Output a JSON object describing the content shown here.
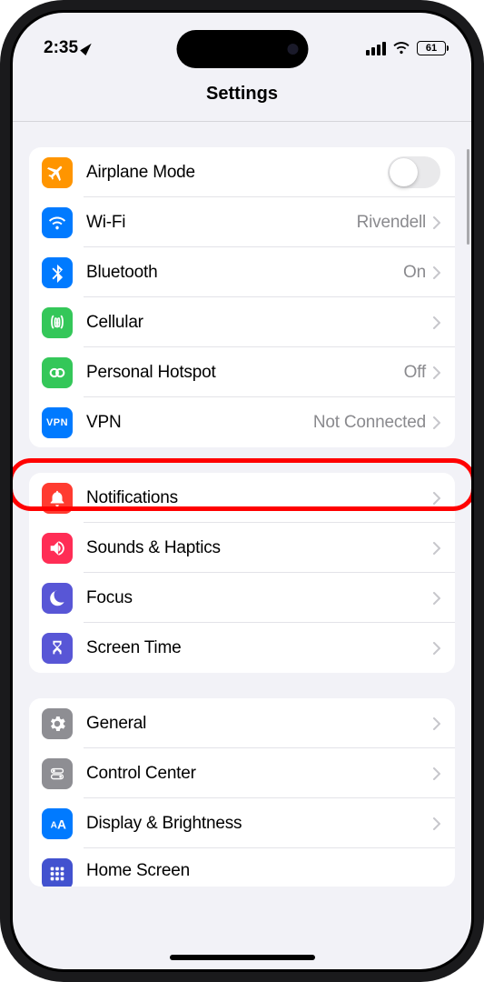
{
  "status": {
    "time": "2:35",
    "battery": "61"
  },
  "header": {
    "title": "Settings"
  },
  "group1": {
    "airplane": {
      "label": "Airplane Mode"
    },
    "wifi": {
      "label": "Wi-Fi",
      "detail": "Rivendell"
    },
    "bluetooth": {
      "label": "Bluetooth",
      "detail": "On"
    },
    "cellular": {
      "label": "Cellular"
    },
    "hotspot": {
      "label": "Personal Hotspot",
      "detail": "Off"
    },
    "vpn": {
      "label": "VPN",
      "detail": "Not Connected",
      "iconText": "VPN"
    }
  },
  "group2": {
    "notifications": {
      "label": "Notifications"
    },
    "sounds": {
      "label": "Sounds & Haptics"
    },
    "focus": {
      "label": "Focus"
    },
    "screentime": {
      "label": "Screen Time"
    }
  },
  "group3": {
    "general": {
      "label": "General"
    },
    "control": {
      "label": "Control Center"
    },
    "display": {
      "label": "Display & Brightness"
    },
    "homescreen": {
      "label": "Home Screen"
    }
  }
}
